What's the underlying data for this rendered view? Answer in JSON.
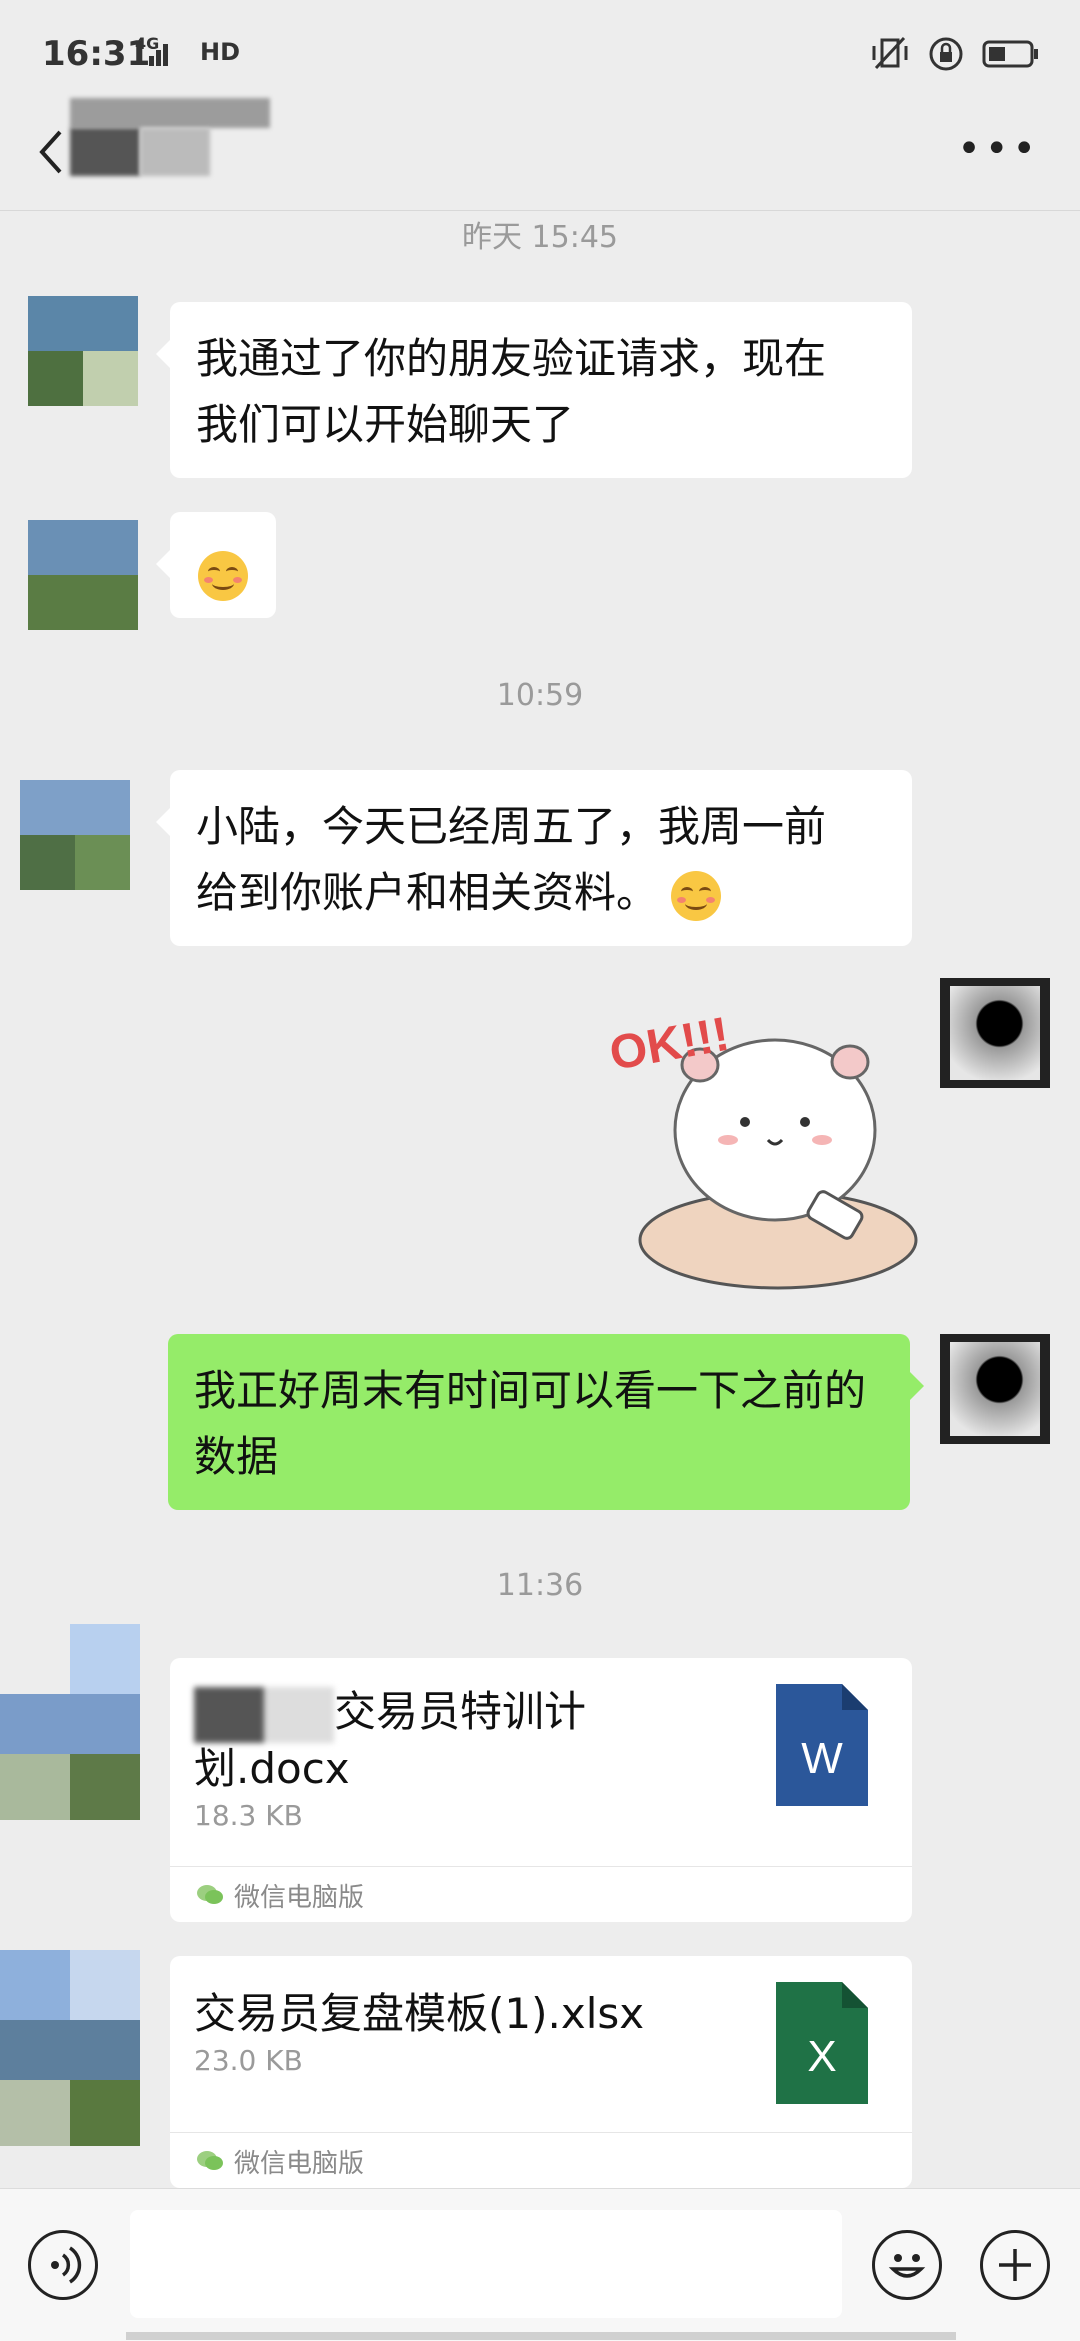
{
  "status_bar": {
    "time": "16:31",
    "network": "4G",
    "hd": "HD",
    "icons": [
      "vibrate-off-icon",
      "rotation-lock-icon",
      "battery-icon"
    ]
  },
  "nav": {
    "back_icon": "chevron-left-icon",
    "more_label": "•••"
  },
  "timestamps": [
    "昨天 15:45",
    "10:59",
    "11:36"
  ],
  "messages": [
    {
      "text_line1": "我通过了你的朋友验证请求，现在",
      "text_line2": "我们可以开始聊天了"
    },
    {
      "emoji": "smiling-face-icon"
    },
    {
      "text_line1": "小陆，今天已经周五了，我周一前",
      "text_line2": "给到你账户和相关资料。"
    },
    {
      "sticker_text": "OK!!!"
    },
    {
      "text_line1": "我正好周末有时间可以看一下之前的",
      "text_line2": "数据"
    }
  ],
  "files": [
    {
      "name_line1": "交易员特训计",
      "name_line2": "划.docx",
      "size": "18.3 KB",
      "icon_letter": "W",
      "source": "微信电脑版"
    },
    {
      "name_line1": "交易员复盘模板(1).xlsx",
      "size": "23.0 KB",
      "icon_letter": "X",
      "source": "微信电脑版"
    }
  ],
  "colors": {
    "sent_bubble": "#95ec69",
    "word_blue": "#2b579a",
    "excel_green": "#1f7246",
    "background": "#ededed"
  }
}
